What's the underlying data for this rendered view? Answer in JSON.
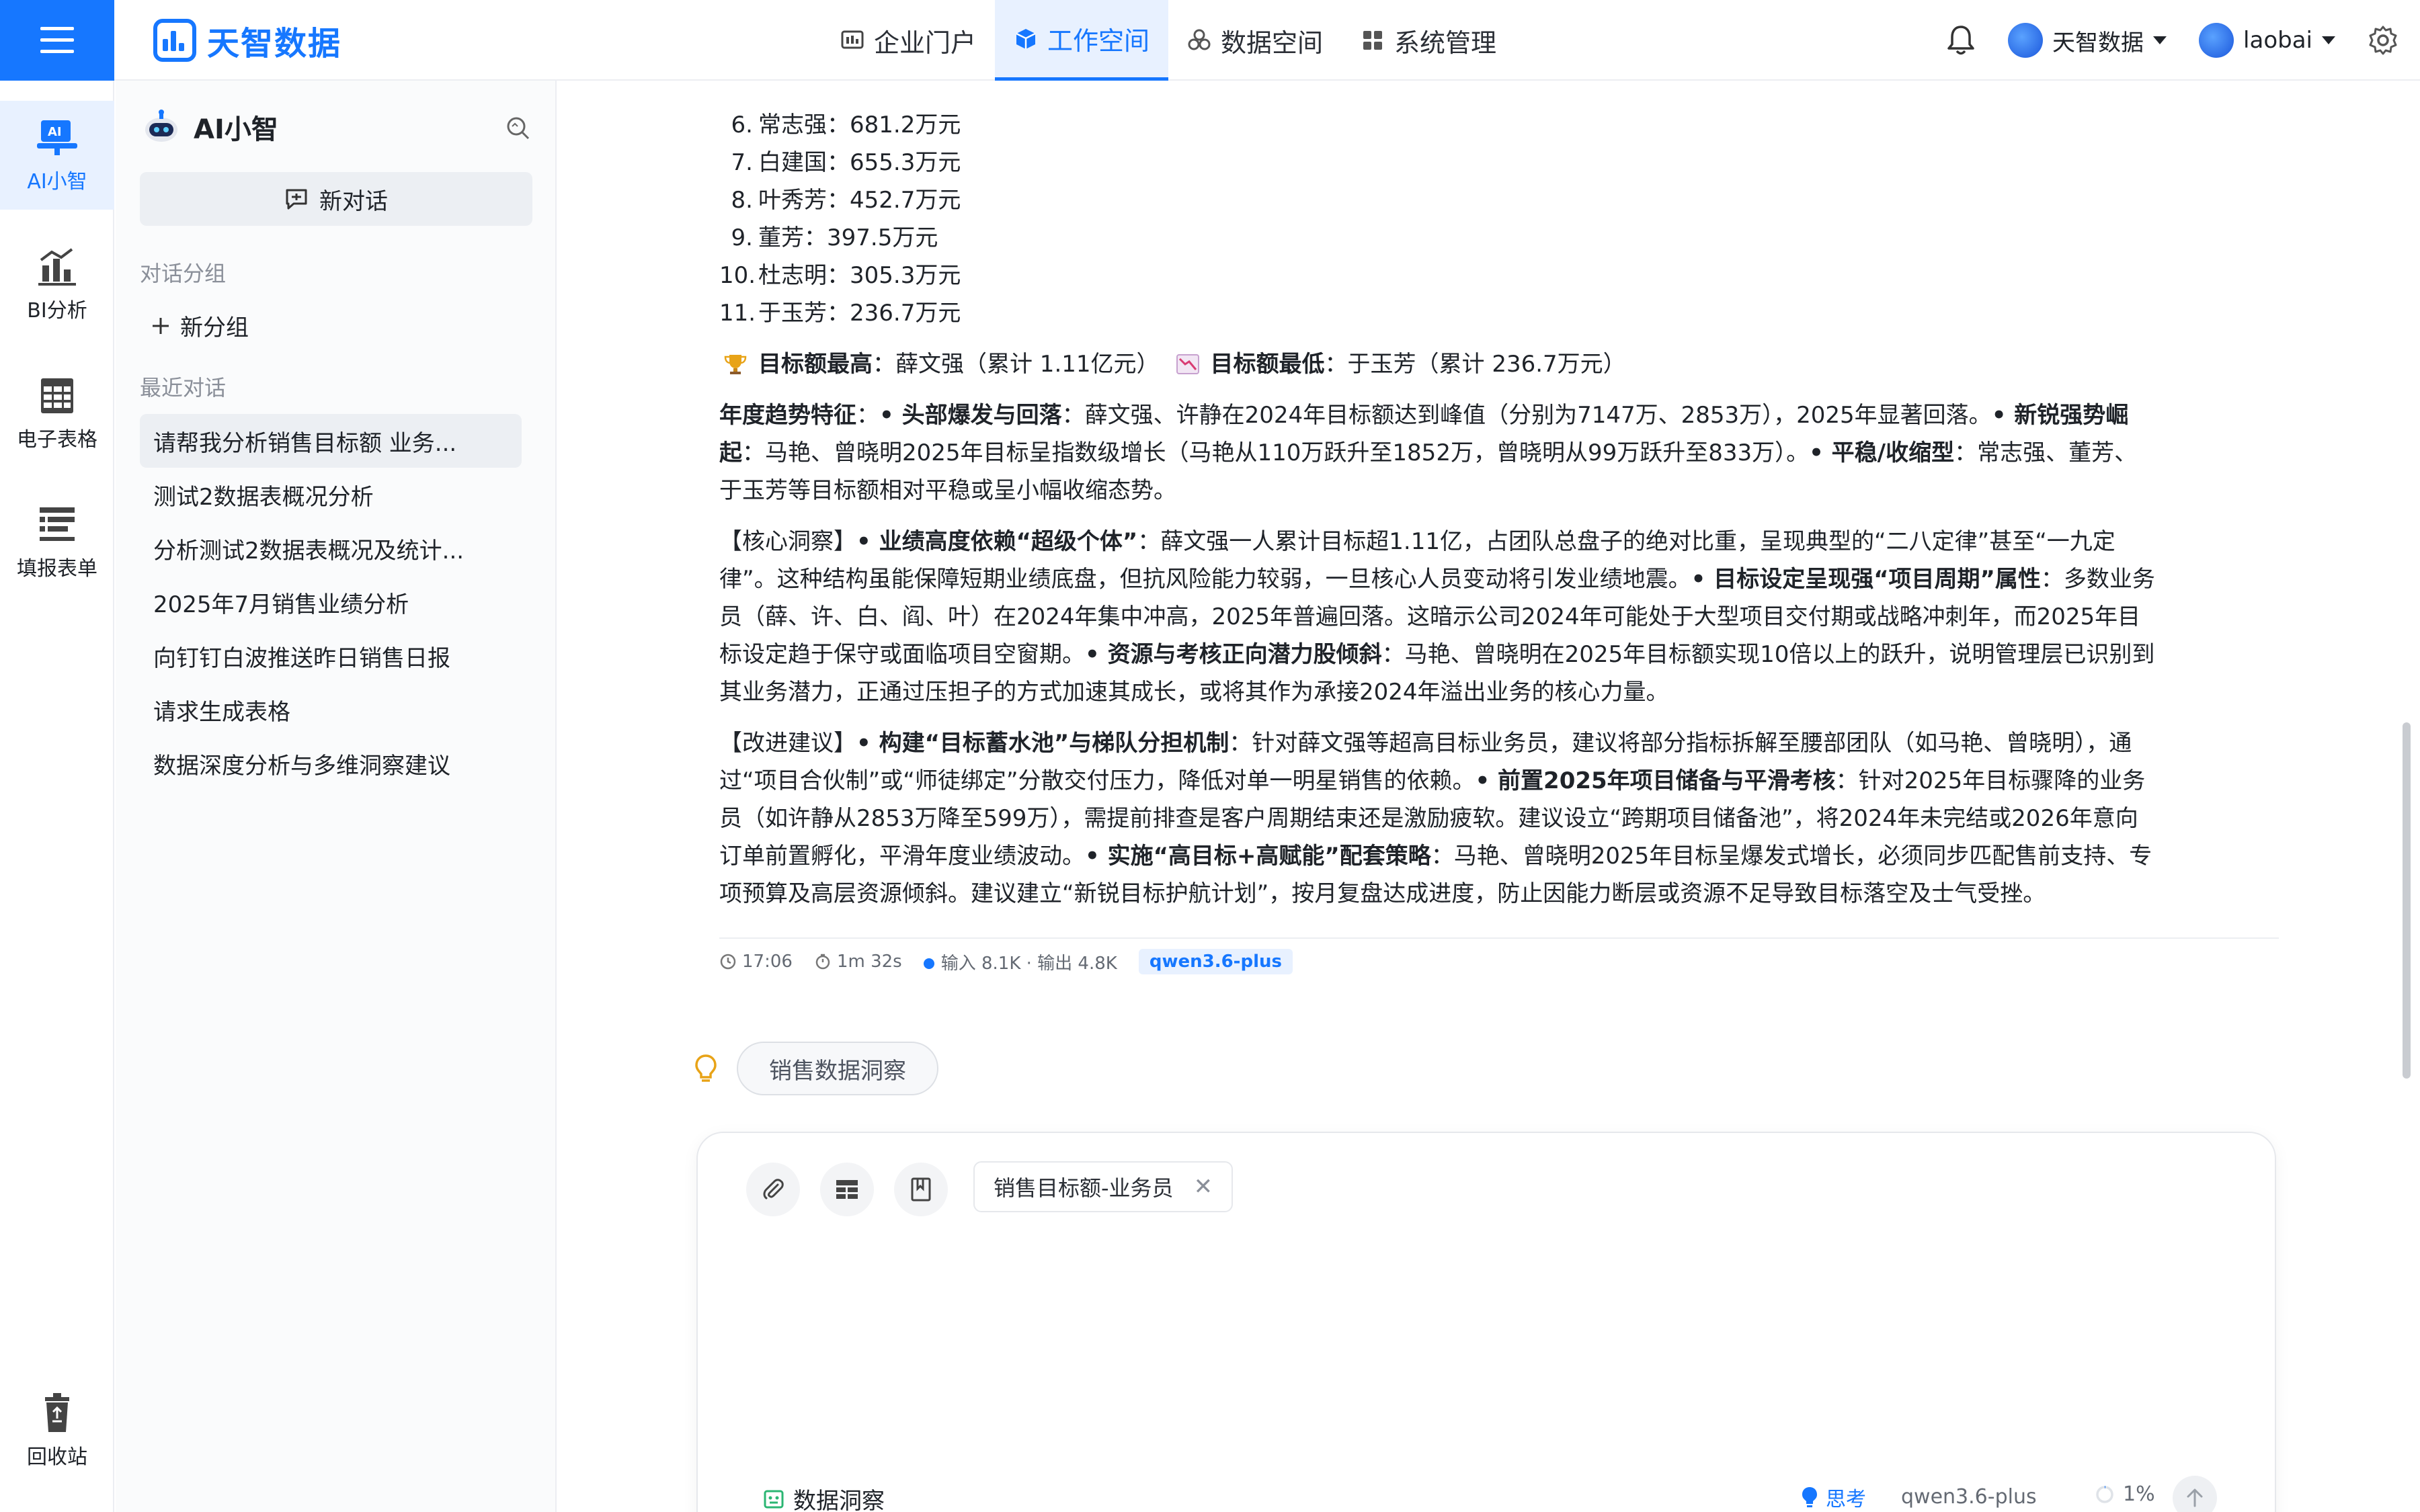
{
  "header": {
    "brand": "天智数据",
    "nav": [
      {
        "label": "企业门户",
        "icon": "portal-icon",
        "active": false
      },
      {
        "label": "工作空间",
        "icon": "workspace-cube-icon",
        "active": true
      },
      {
        "label": "数据空间",
        "icon": "data-space-icon",
        "active": false
      },
      {
        "label": "系统管理",
        "icon": "system-grid-icon",
        "active": false
      }
    ],
    "tenant": "天智数据",
    "user": "laobai"
  },
  "rail": {
    "items": [
      {
        "label": "AI小智",
        "active": true
      },
      {
        "label": "BI分析",
        "active": false
      },
      {
        "label": "电子表格",
        "active": false
      },
      {
        "label": "填报表单",
        "active": false
      }
    ],
    "recycle": "回收站"
  },
  "sidebar": {
    "title": "AI小智",
    "new_chat": "新对话",
    "groups_label": "对话分组",
    "new_group": "新分组",
    "recent_label": "最近对话",
    "conversations": [
      "请帮我分析销售目标额 业务...",
      "测试2数据表概况分析",
      "分析测试2数据表概况及统计...",
      "2025年7月销售业绩分析",
      "向钉钉白波推送昨日销售日报",
      "请求生成表格",
      "数据深度分析与多维洞察建议"
    ]
  },
  "answer": {
    "ranking": [
      {
        "n": "6.",
        "text": "常志强：681.2万元"
      },
      {
        "n": "7.",
        "text": "白建国：655.3万元"
      },
      {
        "n": "8.",
        "text": "叶秀芳：452.7万元"
      },
      {
        "n": "9.",
        "text": "董芳：397.5万元"
      },
      {
        "n": "10.",
        "text": "杜志明：305.3万元"
      },
      {
        "n": "11.",
        "text": "于玉芳：236.7万元"
      }
    ],
    "highest_label": "目标额最高",
    "highest_value": "：薛文强（累计 1.11亿元）",
    "lowest_label": "目标额最低",
    "lowest_value": "：于玉芳（累计 236.7万元）",
    "trend": {
      "title": "年度趋势特征",
      "t1": "：",
      "b1": "• 头部爆发与回落",
      "t2": "：薛文强、许静在2024年目标额达到峰值（分别为7147万、2853万），2025年显著回落。",
      "b2": "• 新锐强势崛起",
      "t3": "：马艳、曾晓明2025年目标呈指数级增长（马艳从110万跃升至1852万，曾晓明从99万跃升至833万）。",
      "b3": "• 平稳/收缩型",
      "t4": "：常志强、董芳、于玉芳等目标额相对平稳或呈小幅收缩态势。"
    },
    "insight": {
      "head": "【核心洞察】",
      "b1": "• 业绩高度依赖“超级个体”",
      "t1": "：薛文强一人累计目标超1.11亿，占团队总盘子的绝对比重，呈现典型的“二八定律”甚至“一九定律”。这种结构虽能保障短期业绩底盘，但抗风险能力较弱，一旦核心人员变动将引发业绩地震。",
      "b2": "• 目标设定呈现强“项目周期”属性",
      "t2": "：多数业务员（薛、许、白、阎、叶）在2024年集中冲高，2025年普遍回落。这暗示公司2024年可能处于大型项目交付期或战略冲刺年，而2025年目标设定趋于保守或面临项目空窗期。",
      "b3": "• 资源与考核正向潜力股倾斜",
      "t3": "：马艳、曾晓明在2025年目标额实现10倍以上的跃升，说明管理层已识别到其业务潜力，正通过压担子的方式加速其成长，或将其作为承接2024年溢出业务的核心力量。"
    },
    "advice": {
      "head": "【改进建议】",
      "b1": "• 构建“目标蓄水池”与梯队分担机制",
      "t1": "：针对薛文强等超高目标业务员，建议将部分指标拆解至腰部团队（如马艳、曾晓明），通过“项目合伙制”或“师徒绑定”分散交付压力，降低对单一明星销售的依赖。",
      "b2": "• 前置2025年项目储备与平滑考核",
      "t2": "：针对2025年目标骤降的业务员（如许静从2853万降至599万），需提前排查是客户周期结束还是激励疲软。建议设立“跨期项目储备池”，将2024年未完结或2026年意向订单前置孵化，平滑年度业绩波动。",
      "b3": "• 实施“高目标+高赋能”配套策略",
      "t3": "：马艳、曾晓明2025年目标呈爆发式增长，必须同步匹配售前支持、专项预算及高层资源倾斜。建议建立“新锐目标护航计划”，按月复盘达成进度，防止因能力断层或资源不足导致目标落空及士气受挫。"
    },
    "meta": {
      "time": "17:06",
      "duration": "1m 32s",
      "tokens": "输入 8.1K · 输出 4.8K",
      "model": "qwen3.6-plus"
    }
  },
  "suggestion": "销售数据洞察",
  "composer": {
    "tag": "销售目标额-业务员",
    "mode": "数据洞察",
    "think": "思考",
    "model": "qwen3.6-plus",
    "usage": "1%"
  },
  "colors": {
    "accent": "#1677ff"
  }
}
